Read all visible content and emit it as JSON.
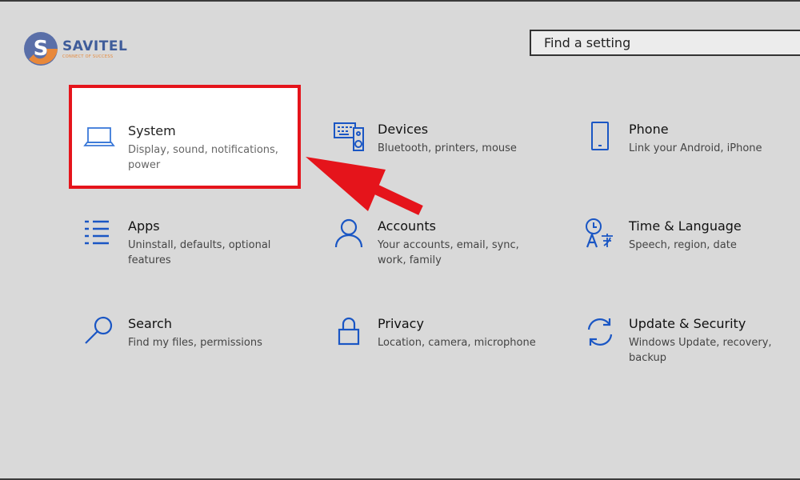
{
  "logo": {
    "name": "SAVITEL",
    "tagline": "CONNECT OF SUCCESS"
  },
  "search": {
    "placeholder": "Find a setting"
  },
  "tiles": [
    {
      "title": "System",
      "desc": "Display, sound, notifications, power",
      "icon": "laptop-icon"
    },
    {
      "title": "Devices",
      "desc": "Bluetooth, printers, mouse",
      "icon": "keyboard-speaker-icon"
    },
    {
      "title": "Phone",
      "desc": "Link your Android, iPhone",
      "icon": "phone-icon"
    },
    {
      "title": "Apps",
      "desc": "Uninstall, defaults, optional features",
      "icon": "list-icon"
    },
    {
      "title": "Accounts",
      "desc": "Your accounts, email, sync, work, family",
      "icon": "person-icon"
    },
    {
      "title": "Time & Language",
      "desc": "Speech, region, date",
      "icon": "clock-language-icon"
    },
    {
      "title": "Search",
      "desc": "Find my files, permissions",
      "icon": "magnifier-icon"
    },
    {
      "title": "Privacy",
      "desc": "Location, camera, microphone",
      "icon": "lock-icon"
    },
    {
      "title": "Update & Security",
      "desc": "Windows Update, recovery, backup",
      "icon": "sync-arrows-icon"
    }
  ],
  "colors": {
    "accent": "#1a56c4",
    "highlight_border": "#e5141b",
    "arrow": "#e5141b",
    "background": "#d9d9d9"
  }
}
